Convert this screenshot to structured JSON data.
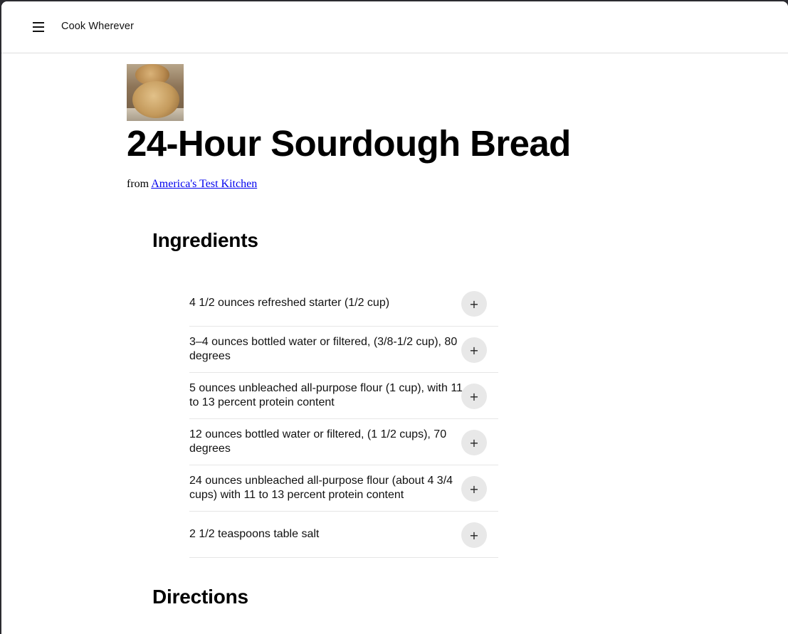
{
  "header": {
    "site_title": "Cook Wherever",
    "menu_icon": "hamburger-menu-icon"
  },
  "recipe": {
    "title": "24-Hour Sourdough Bread",
    "source_prefix": "from ",
    "source_name": "America's Test Kitchen"
  },
  "ingredients": {
    "heading": "Ingredients",
    "add_icon": "plus-icon",
    "add_symbol": "+",
    "items": [
      {
        "text": "4 1/2 ounces refreshed starter (1/2 cup)"
      },
      {
        "text": "3–4 ounces bottled water or filtered, (3/8-1/2 cup), 80 degrees"
      },
      {
        "text": "5 ounces unbleached all-purpose flour (1 cup), with 11 to 13 percent protein content"
      },
      {
        "text": "12 ounces bottled water or filtered, (1 1/2 cups), 70 degrees"
      },
      {
        "text": "24 ounces unbleached all-purpose flour (about 4 3/4 cups) with 11 to 13 percent protein content"
      },
      {
        "text": "2 1/2 teaspoons table salt"
      }
    ]
  },
  "directions": {
    "heading": "Directions"
  }
}
